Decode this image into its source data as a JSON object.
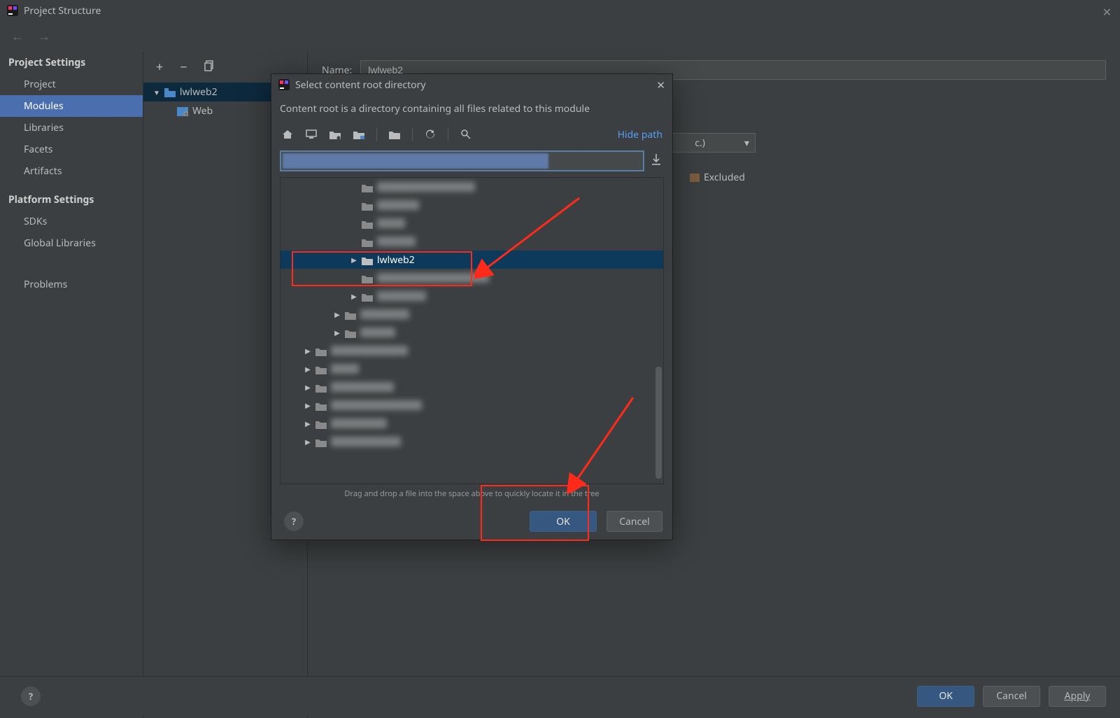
{
  "window": {
    "title": "Project Structure"
  },
  "sidebar": {
    "h1": "Project Settings",
    "items1": [
      "Project",
      "Modules",
      "Libraries",
      "Facets",
      "Artifacts"
    ],
    "selected1": 1,
    "h2": "Platform Settings",
    "items2": [
      "SDKs",
      "Global Libraries"
    ],
    "problems": "Problems"
  },
  "tree": {
    "module": "lwlweb2",
    "facet": "Web"
  },
  "right": {
    "name_label": "Name:",
    "name_value": "lwlweb2",
    "combo_tail": "c.)",
    "mark_label": "Excluded"
  },
  "footer": {
    "ok": "OK",
    "cancel": "Cancel",
    "apply": "Apply"
  },
  "modal": {
    "title": "Select content root directory",
    "desc": "Content root is a directory containing all files related to this module",
    "hide_path": "Hide path",
    "selected_folder": "lwlweb2",
    "hint": "Drag and drop a file into the space above to quickly locate it in the tree",
    "ok": "OK",
    "cancel": "Cancel"
  },
  "colors": {
    "red": "#ff2a1a",
    "link": "#589df6",
    "blue_btn": "#365880"
  }
}
